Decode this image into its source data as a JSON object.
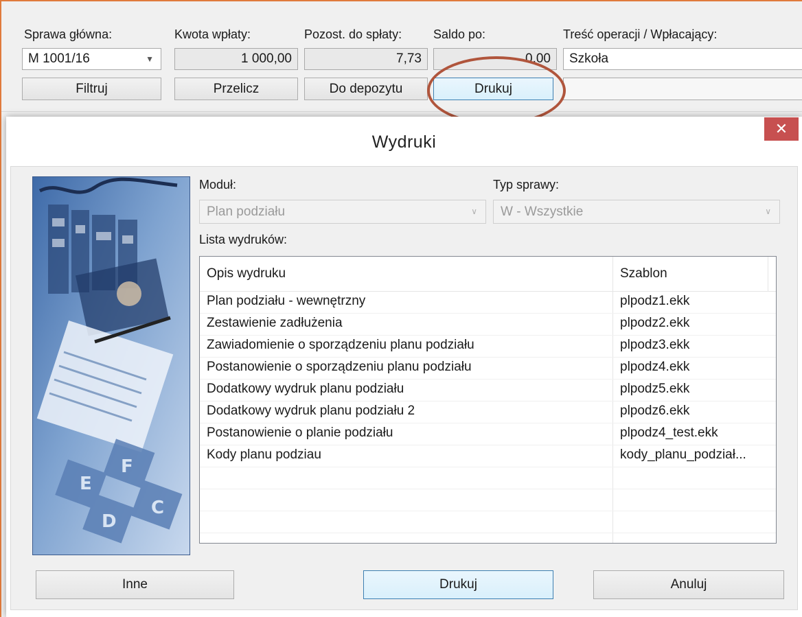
{
  "form": {
    "labels": {
      "sprawa": "Sprawa główna:",
      "kwota": "Kwota wpłaty:",
      "pozost": "Pozost. do spłaty:",
      "saldo": "Saldo po:",
      "tresc": "Treść operacji / Wpłacający:"
    },
    "sprawa_value": "M 1001/16",
    "kwota_value": "1 000,00",
    "pozost_value": "7,73",
    "saldo_value": "0,00",
    "tresc_value": "Szkoła",
    "buttons": {
      "filtruj": "Filtruj",
      "przelicz": "Przelicz",
      "depozyt": "Do depozytu",
      "drukuj": "Drukuj"
    }
  },
  "dialog": {
    "title": "Wydruki",
    "close_glyph": "✕",
    "modul_label": "Moduł:",
    "modul_value": "Plan podziału",
    "typ_label": "Typ sprawy:",
    "typ_value": "W - Wszystkie",
    "lista_label": "Lista wydruków:",
    "columns": [
      "Opis wydruku",
      "Szablon"
    ],
    "rows": [
      {
        "opis": "Plan podziału - wewnętrzny",
        "szablon": "plpodz1.ekk"
      },
      {
        "opis": "Zestawienie zadłużenia",
        "szablon": "plpodz2.ekk"
      },
      {
        "opis": "Zawiadomienie o sporządzeniu planu podziału",
        "szablon": "plpodz3.ekk"
      },
      {
        "opis": "Postanowienie o sporządzeniu planu podziału",
        "szablon": "plpodz4.ekk"
      },
      {
        "opis": "Dodatkowy wydruk planu podziału",
        "szablon": "plpodz5.ekk"
      },
      {
        "opis": "Dodatkowy wydruk planu podziału 2",
        "szablon": "plpodz6.ekk"
      },
      {
        "opis": "Postanowienie o planie podziału",
        "szablon": "plpodz4_test.ekk"
      },
      {
        "opis": "Kody planu podziau",
        "szablon": "kody_planu_podział..."
      }
    ],
    "buttons": {
      "inne": "Inne",
      "drukuj": "Drukuj",
      "anuluj": "Anuluj"
    }
  },
  "colors": {
    "highlight_ring": "#b0553c",
    "close_button": "#c75050",
    "focused_button_border": "#3c7fb1"
  }
}
